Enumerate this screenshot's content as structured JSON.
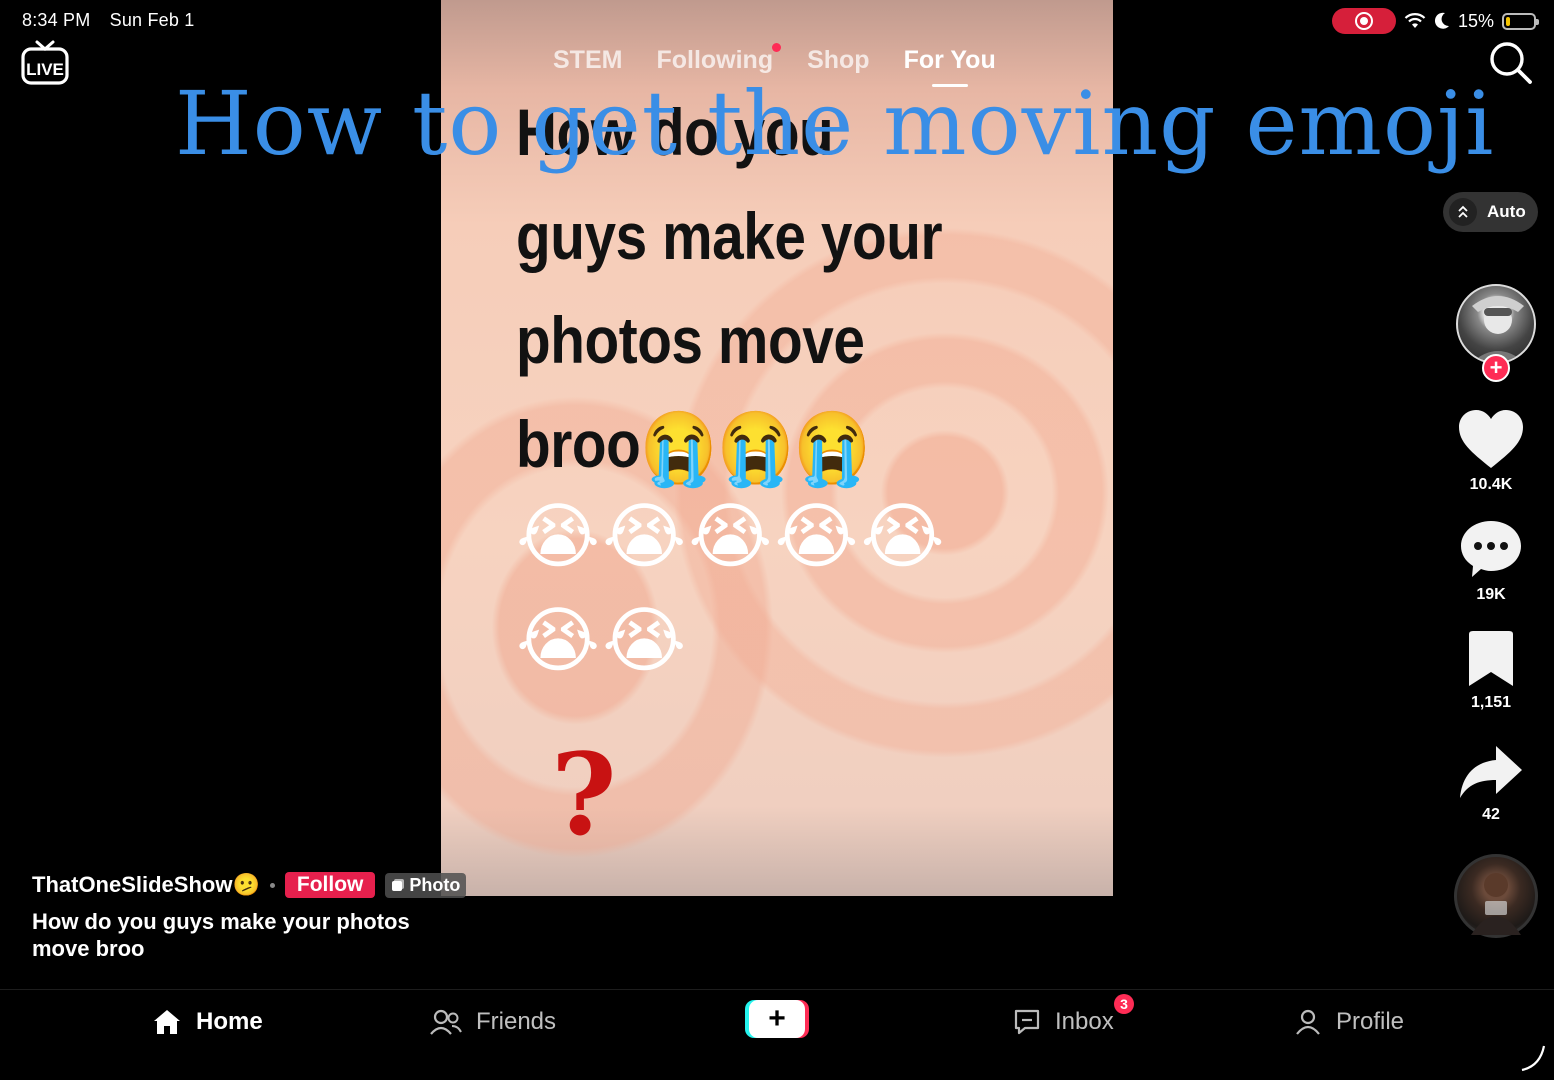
{
  "status_bar": {
    "time": "8:34 PM",
    "date": "Sun Feb 1",
    "battery": "15%",
    "battery_level": 0.15
  },
  "header": {
    "live_label": "LIVE",
    "tabs": [
      {
        "label": "STEM",
        "active": false
      },
      {
        "label": "Following",
        "active": false,
        "has_dot": true
      },
      {
        "label": "Shop",
        "active": false
      },
      {
        "label": "For You",
        "active": true
      }
    ]
  },
  "overlay_caption": "How to get the moving emoji",
  "post": {
    "image_text_lines": [
      "How do you",
      "guys make your",
      "photos move",
      "broo"
    ],
    "emoji": "😭",
    "emoji_rows": [
      "😭😭😭",
      "😭😭😭😭😭",
      "😭😭"
    ],
    "question_mark": "?"
  },
  "quality": {
    "label": "Auto"
  },
  "actions": {
    "likes": "10.4K",
    "comments": "19K",
    "saves": "1,151",
    "shares": "42"
  },
  "author": {
    "name": "ThatOneSlideShow",
    "emoji": "🫤",
    "follow_label": "Follow",
    "type_label": "Photo"
  },
  "description": "How do you guys make your photos move broo",
  "nav": {
    "home": "Home",
    "friends": "Friends",
    "create": "+",
    "inbox": "Inbox",
    "inbox_badge": "3",
    "profile": "Profile"
  },
  "colors": {
    "accent": "#fe2c55",
    "caption_blue": "#3a8ee6",
    "follow_red": "#e6204d"
  }
}
